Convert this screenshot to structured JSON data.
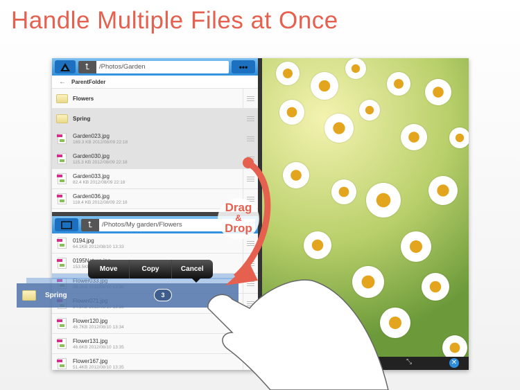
{
  "headline": "Handle Multiple Files at Once",
  "top_pane": {
    "path": "/Photos/Garden",
    "parent": "ParentFolder",
    "rows": [
      {
        "type": "folder",
        "name": "Flowers",
        "selected": false
      },
      {
        "type": "folder",
        "name": "Spring",
        "selected": true
      },
      {
        "type": "file",
        "name": "Garden023.jpg",
        "meta": "169.3 KB  2012/08/09 22:18",
        "selected": true
      },
      {
        "type": "file",
        "name": "Garden030.jpg",
        "meta": "115.3 KB  2012/08/09 22:18",
        "selected": true
      },
      {
        "type": "file",
        "name": "Garden033.jpg",
        "meta": "82.4 KB  2012/08/09 22:18",
        "selected": false
      },
      {
        "type": "file",
        "name": "Garden036.jpg",
        "meta": "118.4 KB  2012/08/09 22:18",
        "selected": false
      }
    ]
  },
  "bottom_pane": {
    "path": "/Photos/My garden/Flowers",
    "rows": [
      {
        "name": "0194.jpg",
        "meta": "64.1KB  2012/08/10 13:33"
      },
      {
        "name": "0195Nature.jpg",
        "meta": "153.5KB"
      },
      {
        "name": "Flower033.jpg",
        "meta": "26.2KB  2012/08/10 13:38"
      },
      {
        "name": "Flower071.jpg",
        "meta": "84.5KB  2012/08/10 13:38"
      },
      {
        "name": "Flower120.jpg",
        "meta": "46.7KB  2012/08/10 13:34"
      },
      {
        "name": "Flower131.jpg",
        "meta": "46.6KB  2012/08/10 13:35"
      },
      {
        "name": "Flower167.jpg",
        "meta": "51.4KB  2012/08/10 13:35"
      }
    ]
  },
  "drag_item": {
    "name": "Spring",
    "count": "3"
  },
  "popup": {
    "move": "Move",
    "copy": "Copy",
    "cancel": "Cancel"
  },
  "callout": {
    "drag": "Drag",
    "amp": "&",
    "drop": "Drop"
  },
  "colors": {
    "accent": "#e5604f",
    "toolbar": "#2f8fdd"
  }
}
